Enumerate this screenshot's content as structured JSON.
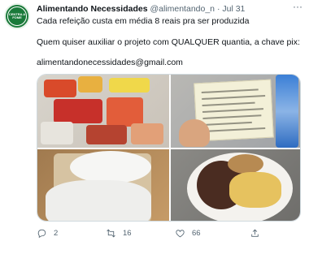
{
  "tweet": {
    "display_name": "Alimentando Necessidades",
    "handle": "@alimentando_n",
    "separator": "·",
    "date": "Jul 31",
    "more_label": "···",
    "avatar_text": "CENTRA A FOME",
    "lines": [
      "Cada refeição custa em média 8 reais pra ser produzida",
      "Quem quiser auxiliar o projeto com QUALQUER quantia, a chave pix:",
      "alimentandonecessidades@gmail.com"
    ],
    "photos": [
      {
        "icon": "photo-grocery-bags"
      },
      {
        "icon": "photo-receipt"
      },
      {
        "icon": "photo-food-sacks"
      },
      {
        "icon": "photo-meal-bowl"
      }
    ],
    "actions": {
      "reply_count": "2",
      "retweet_count": "16",
      "like_count": "66",
      "share_label": ""
    }
  },
  "colors": {
    "text": "#0f1419",
    "secondary": "#536471",
    "avatar_bg": "#1a7a3a",
    "border": "#cfd9de"
  }
}
